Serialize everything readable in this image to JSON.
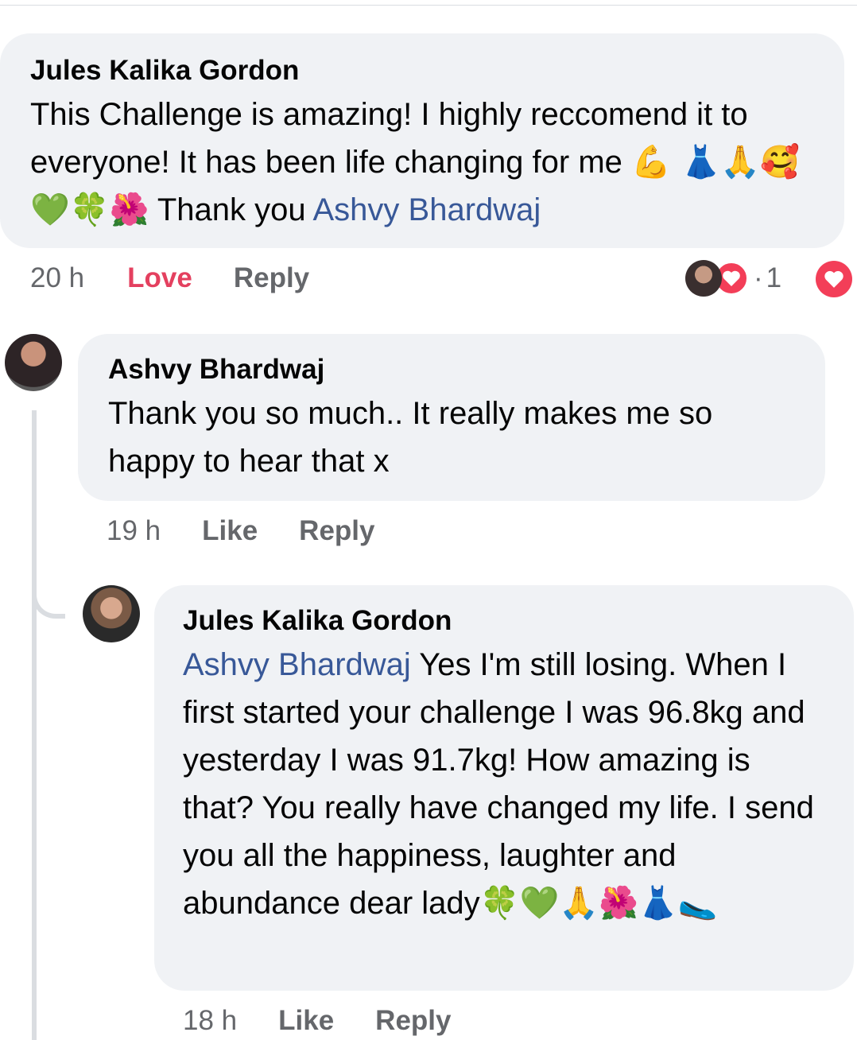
{
  "comment1": {
    "author": "Jules Kalika Gordon",
    "text_before": "This Challenge is amazing! I highly reccomend it to everyone! It has been life changing for me ",
    "emojis": "💪 👗🙏🥰💚🍀🌺",
    "text_after": " Thank you ",
    "mention": "Ashvy Bhardwaj",
    "time": "20 h",
    "love_label": "Love",
    "reply_label": "Reply",
    "reaction_count": "1",
    "dot": "·"
  },
  "reply1": {
    "author": "Ashvy Bhardwaj",
    "text": "Thank you so much.. It really makes me so happy to hear that x",
    "time": "19 h",
    "like_label": "Like",
    "reply_label": "Reply"
  },
  "reply2": {
    "author": "Jules Kalika Gordon",
    "mention": "Ashvy Bhardwaj",
    "text": " Yes I'm still losing. When I first started your challenge I was 96.8kg and yesterday I was 91.7kg! How amazing is that? You really have changed my life. I send you all the happiness, laughter and abundance dear lady",
    "emojis": "🍀💚🙏🌺👗🥿",
    "time": "18 h",
    "like_label": "Like",
    "reply_label": "Reply"
  },
  "colors": {
    "bubble": "#f0f2f5",
    "mention": "#385898",
    "love": "#e4405f",
    "meta": "#65676b"
  },
  "icons": [
    "heart-reaction-icon",
    "avatar"
  ]
}
